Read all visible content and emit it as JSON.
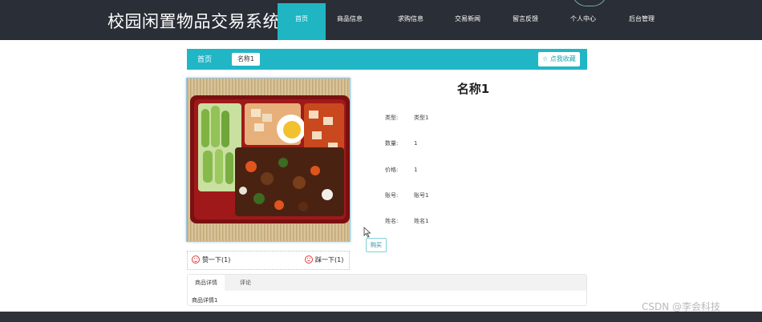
{
  "header": {
    "site_title": "校园闲置物品交易系统",
    "nav": [
      "首页",
      "商品信息",
      "求购信息",
      "交易新闻",
      "留言反馈",
      "个人中心",
      "后台管理"
    ],
    "active_index": 0
  },
  "breadcrumb": {
    "home": "首页",
    "current": "名称1"
  },
  "favorite_label": "☆ 点我收藏",
  "product": {
    "name": "名称1",
    "fields": [
      {
        "label": "类型:",
        "value": "类型1"
      },
      {
        "label": "数量:",
        "value": "1"
      },
      {
        "label": "价格:",
        "value": "1"
      },
      {
        "label": "账号:",
        "value": "账号1"
      },
      {
        "label": "姓名:",
        "value": "姓名1"
      }
    ],
    "buy_label": "购买"
  },
  "votes": {
    "like": "赞一下(1)",
    "dislike": "踩一下(1)"
  },
  "tabs": {
    "items": [
      "商品详情",
      "评论"
    ],
    "content": "商品详情1"
  },
  "watermark": "CSDN @李会科技",
  "colors": {
    "topbar": "#2a2e36",
    "accent": "#1fb5c3",
    "footer": "#2f3238"
  }
}
